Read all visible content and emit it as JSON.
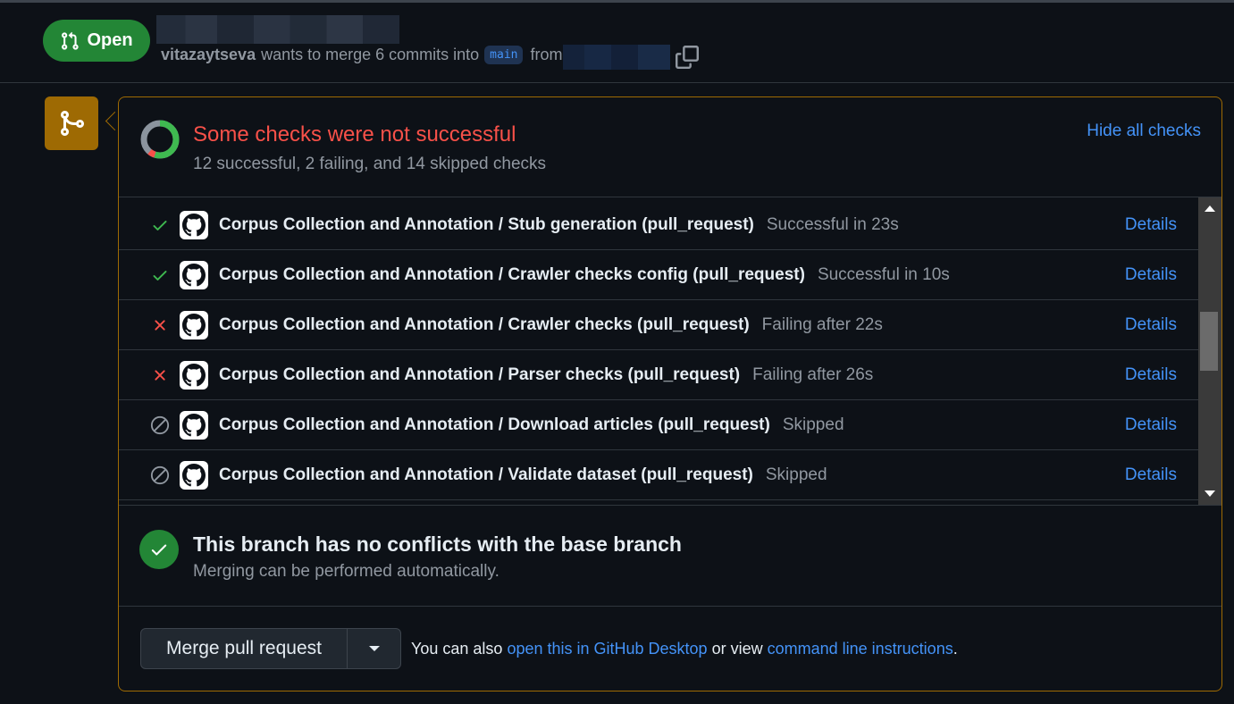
{
  "header": {
    "state": "Open",
    "author": "vitazaytseva",
    "merge_text": "wants to merge 6 commits into",
    "base_branch": "main",
    "from_text": "from"
  },
  "checks": {
    "title": "Some checks were not successful",
    "summary": "12 successful, 2 failing, and 14 skipped checks",
    "hide_link": "Hide all checks",
    "donut": {
      "successful": 12,
      "failing": 2,
      "skipped": 14
    },
    "items": [
      {
        "status": "success",
        "name": "Corpus Collection and Annotation / Stub generation (pull_request)",
        "desc": "Successful in 23s",
        "link": "Details"
      },
      {
        "status": "success",
        "name": "Corpus Collection and Annotation / Crawler checks config (pull_request)",
        "desc": "Successful in 10s",
        "link": "Details"
      },
      {
        "status": "failure",
        "name": "Corpus Collection and Annotation / Crawler checks (pull_request)",
        "desc": "Failing after 22s",
        "link": "Details"
      },
      {
        "status": "failure",
        "name": "Corpus Collection and Annotation / Parser checks (pull_request)",
        "desc": "Failing after 26s",
        "link": "Details"
      },
      {
        "status": "skipped",
        "name": "Corpus Collection and Annotation / Download articles (pull_request)",
        "desc": "Skipped",
        "link": "Details"
      },
      {
        "status": "skipped",
        "name": "Corpus Collection and Annotation / Validate dataset (pull_request)",
        "desc": "Skipped",
        "link": "Details"
      }
    ]
  },
  "conflicts": {
    "title": "This branch has no conflicts with the base branch",
    "subtitle": "Merging can be performed automatically."
  },
  "merge": {
    "button_label": "Merge pull request",
    "note_prefix": "You can also",
    "desktop_link": "open this in GitHub Desktop",
    "note_mid": "or view",
    "cli_link": "command line instructions",
    "note_suffix": "."
  },
  "colors": {
    "success": "#3fb950",
    "failure": "#f85149",
    "skipped": "#9198a1",
    "accent": "#4493f8",
    "warning_border": "#9e6a03"
  }
}
